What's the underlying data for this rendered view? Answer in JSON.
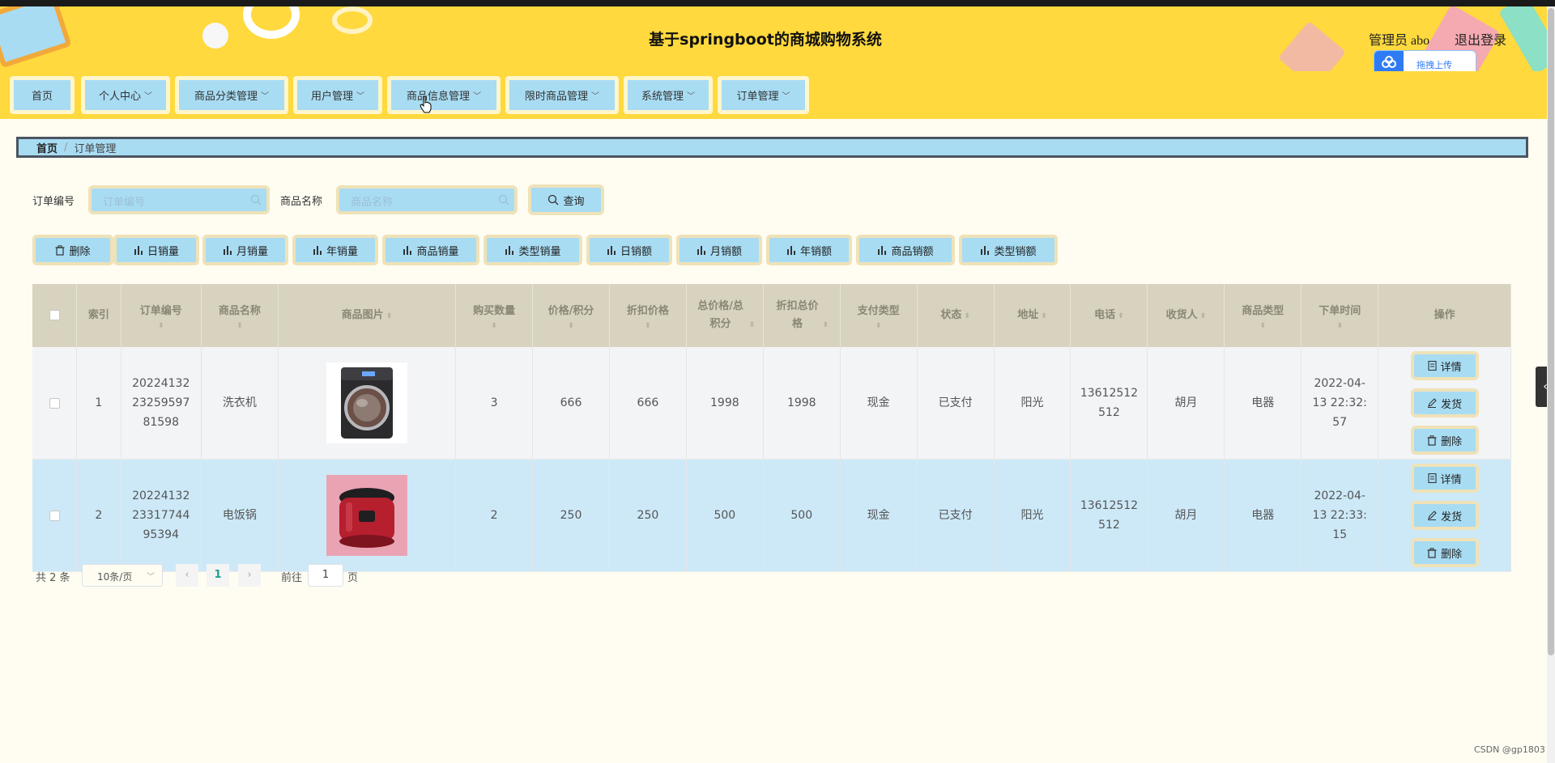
{
  "header": {
    "title": "基于springboot的商城购物系统",
    "admin_label": "管理员 abo",
    "logout_label": "退出登录",
    "upload_label": "拖拽上传"
  },
  "nav": [
    {
      "label": "首页",
      "has_menu": false
    },
    {
      "label": "个人中心",
      "has_menu": true
    },
    {
      "label": "商品分类管理",
      "has_menu": true
    },
    {
      "label": "用户管理",
      "has_menu": true
    },
    {
      "label": "商品信息管理",
      "has_menu": true
    },
    {
      "label": "限时商品管理",
      "has_menu": true
    },
    {
      "label": "系统管理",
      "has_menu": true
    },
    {
      "label": "订单管理",
      "has_menu": true
    }
  ],
  "breadcrumb": {
    "home": "首页",
    "sep": "/",
    "current": "订单管理"
  },
  "search": {
    "order_label": "订单编号",
    "order_placeholder": "订单编号",
    "product_label": "商品名称",
    "product_placeholder": "商品名称",
    "query_label": "查询"
  },
  "toolbar": [
    "删除",
    "日销量",
    "月销量",
    "年销量",
    "商品销量",
    "类型销量",
    "日销额",
    "月销额",
    "年销额",
    "商品销额",
    "类型销额"
  ],
  "table": {
    "headers": {
      "index": "索引",
      "order_no": "订单编号",
      "product": "商品名称",
      "image": "商品图片",
      "qty": "购买数量",
      "price": "价格/积分",
      "discount_price": "折扣价格",
      "total": "总价格/总积分",
      "discount_total": "折扣总价格",
      "pay_type": "支付类型",
      "status": "状态",
      "address": "地址",
      "phone": "电话",
      "receiver": "收货人",
      "category": "商品类型",
      "time": "下单时间",
      "actions": "操作"
    },
    "rows": [
      {
        "index": "1",
        "order_no": "2022413223259597 81598",
        "order_no_lines": [
          "20224132",
          "23259597",
          "81598"
        ],
        "product": "洗衣机",
        "image": "washing-machine",
        "qty": "3",
        "price": "666",
        "discount_price": "666",
        "total": "1998",
        "discount_total": "1998",
        "pay_type": "现金",
        "status": "已支付",
        "address": "阳光",
        "phone_lines": [
          "13612512",
          "512"
        ],
        "receiver": "胡月",
        "category": "电器",
        "time_lines": [
          "2022-04-",
          "13 22:32:",
          "57"
        ]
      },
      {
        "index": "2",
        "order_no_lines": [
          "20224132",
          "23317744",
          "95394"
        ],
        "product": "电饭锅",
        "image": "rice-cooker",
        "qty": "2",
        "price": "250",
        "discount_price": "250",
        "total": "500",
        "discount_total": "500",
        "pay_type": "现金",
        "status": "已支付",
        "address": "阳光",
        "phone_lines": [
          "13612512",
          "512"
        ],
        "receiver": "胡月",
        "category": "电器",
        "time_lines": [
          "2022-04-",
          "13 22:33:",
          "15"
        ]
      }
    ],
    "actions": {
      "detail": "详情",
      "ship": "发货",
      "delete": "删除"
    }
  },
  "pagination": {
    "total_label": "共 2 条",
    "page_size": "10条/页",
    "current_page": "1",
    "goto_prefix": "前往",
    "goto_value": "1",
    "goto_suffix": "页"
  },
  "watermark": "CSDN @gp1803",
  "colors": {
    "header_yellow": "#ffd93d",
    "button_blue": "#a8dcf3",
    "button_border": "#efe2b8",
    "table_header": "#d8d3bf",
    "selected_row": "#cde9f8"
  }
}
